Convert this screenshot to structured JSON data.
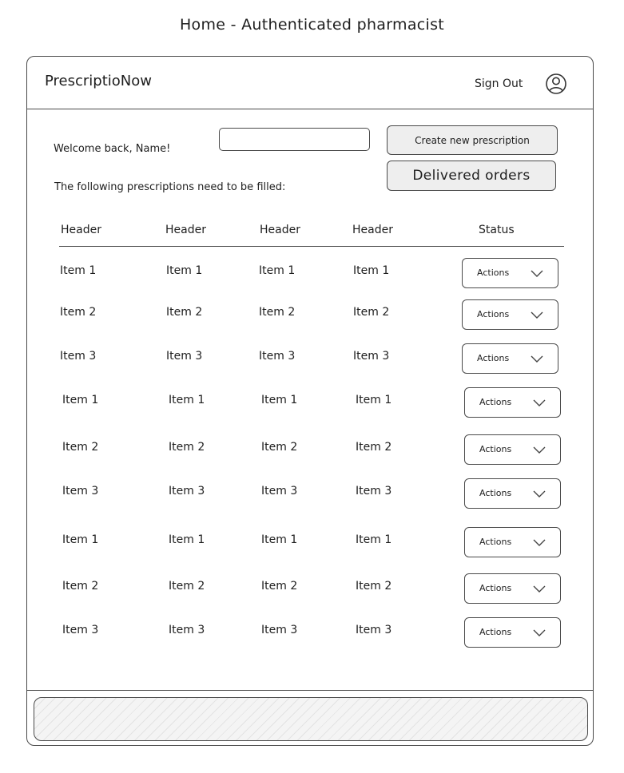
{
  "page_title": "Home - Authenticated pharmacist",
  "navbar": {
    "brand": "PrescriptioNow",
    "sign_out": "Sign Out",
    "user_icon": "user-circle-icon"
  },
  "welcome": "Welcome back, Name!",
  "search": {
    "value": "",
    "placeholder": ""
  },
  "buttons": {
    "create": "Create new prescription",
    "delivered": "Delivered orders"
  },
  "instruction": "The following prescriptions need to be filled:",
  "table": {
    "headers": [
      "Header",
      "Header",
      "Header",
      "Header",
      "Status"
    ],
    "rows": [
      {
        "cells": [
          "Item 1",
          "Item 1",
          "Item 1",
          "Item 1"
        ],
        "action": "Actions"
      },
      {
        "cells": [
          "Item 2",
          "Item 2",
          "Item 2",
          "Item 2"
        ],
        "action": "Actions"
      },
      {
        "cells": [
          "Item 3",
          "Item 3",
          "Item 3",
          "Item 3"
        ],
        "action": "Actions"
      },
      {
        "cells": [
          "Item 1",
          "Item 1",
          "Item 1",
          "Item 1"
        ],
        "action": "Actions"
      },
      {
        "cells": [
          "Item 2",
          "Item 2",
          "Item 2",
          "Item 2"
        ],
        "action": "Actions"
      },
      {
        "cells": [
          "Item 3",
          "Item 3",
          "Item 3",
          "Item 3"
        ],
        "action": "Actions"
      },
      {
        "cells": [
          "Item 1",
          "Item 1",
          "Item 1",
          "Item 1"
        ],
        "action": "Actions"
      },
      {
        "cells": [
          "Item 2",
          "Item 2",
          "Item 2",
          "Item 2"
        ],
        "action": "Actions"
      },
      {
        "cells": [
          "Item 3",
          "Item 3",
          "Item 3",
          "Item 3"
        ],
        "action": "Actions"
      }
    ]
  },
  "icons": {
    "dropdown": "chevron-down-icon"
  }
}
